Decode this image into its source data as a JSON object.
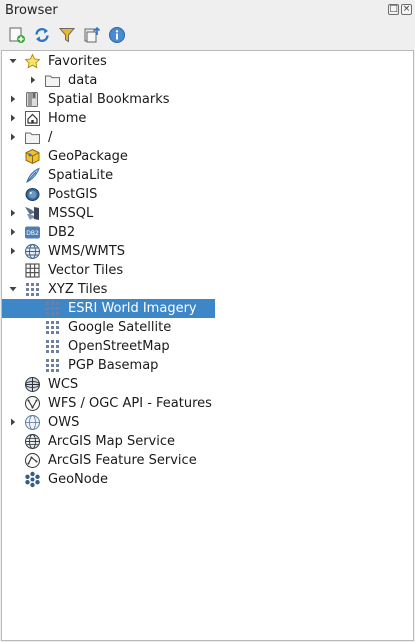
{
  "window": {
    "title": "Browser"
  },
  "title_buttons": {
    "float": "□",
    "close": "×"
  },
  "toolbar": {
    "tools": [
      {
        "name": "add-layer-icon"
      },
      {
        "name": "refresh-icon"
      },
      {
        "name": "filter-icon"
      },
      {
        "name": "collapse-all-icon"
      },
      {
        "name": "info-icon"
      }
    ]
  },
  "colors": {
    "selection": "#3d87c8",
    "panel_bg": "#efefef",
    "tree_bg": "#ffffff"
  },
  "tree": {
    "items": [
      {
        "label": "Favorites",
        "icon": "star-icon",
        "expander": "expanded",
        "level": 0
      },
      {
        "label": "data",
        "icon": "folder-icon",
        "expander": "collapsed",
        "level": 1
      },
      {
        "label": "Spatial Bookmarks",
        "icon": "bookmarks-icon",
        "expander": "collapsed",
        "level": 0
      },
      {
        "label": "Home",
        "icon": "home-icon",
        "expander": "collapsed",
        "level": 0
      },
      {
        "label": "/",
        "icon": "folder-icon",
        "expander": "collapsed",
        "level": 0
      },
      {
        "label": "GeoPackage",
        "icon": "geopackage-icon",
        "expander": "none",
        "level": 0
      },
      {
        "label": "SpatiaLite",
        "icon": "spatialite-icon",
        "expander": "none",
        "level": 0
      },
      {
        "label": "PostGIS",
        "icon": "postgis-icon",
        "expander": "none",
        "level": 0
      },
      {
        "label": "MSSQL",
        "icon": "mssql-icon",
        "expander": "collapsed",
        "level": 0
      },
      {
        "label": "DB2",
        "icon": "db2-icon",
        "expander": "collapsed",
        "level": 0
      },
      {
        "label": "WMS/WMTS",
        "icon": "globe-icon",
        "expander": "collapsed",
        "level": 0
      },
      {
        "label": "Vector Tiles",
        "icon": "grid-icon",
        "expander": "none",
        "level": 0
      },
      {
        "label": "XYZ Tiles",
        "icon": "tiles-icon",
        "expander": "expanded",
        "level": 0
      },
      {
        "label": "ESRI World Imagery",
        "icon": "tiles-icon",
        "expander": "none",
        "level": 1,
        "selected": true
      },
      {
        "label": "Google Satellite",
        "icon": "tiles-icon",
        "expander": "none",
        "level": 1
      },
      {
        "label": "OpenStreetMap",
        "icon": "tiles-icon",
        "expander": "none",
        "level": 1
      },
      {
        "label": "PGP Basemap",
        "icon": "tiles-icon",
        "expander": "none",
        "level": 1
      },
      {
        "label": "WCS",
        "icon": "wcs-icon",
        "expander": "none",
        "level": 0
      },
      {
        "label": "WFS / OGC API - Features",
        "icon": "wfs-icon",
        "expander": "none",
        "level": 0
      },
      {
        "label": "OWS",
        "icon": "ows-icon",
        "expander": "collapsed",
        "level": 0
      },
      {
        "label": "ArcGIS Map Service",
        "icon": "arcgis-map-icon",
        "expander": "none",
        "level": 0
      },
      {
        "label": "ArcGIS Feature Service",
        "icon": "arcgis-feature-icon",
        "expander": "none",
        "level": 0
      },
      {
        "label": "GeoNode",
        "icon": "geonode-icon",
        "expander": "none",
        "level": 0
      }
    ]
  }
}
